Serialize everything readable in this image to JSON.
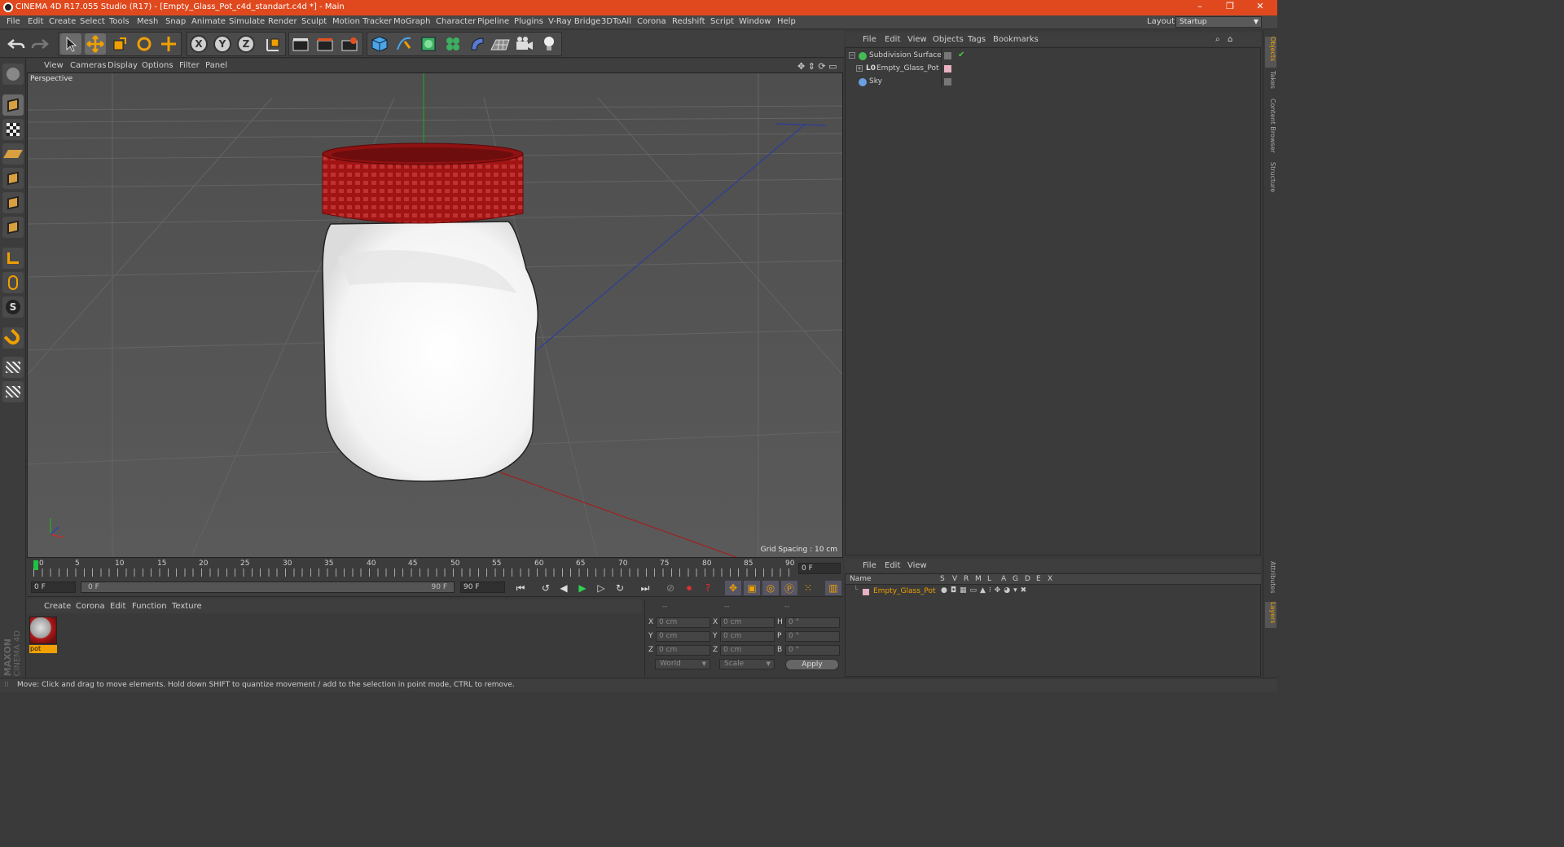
{
  "window": {
    "title": "CINEMA 4D R17.055 Studio (R17) - [Empty_Glass_Pot_c4d_standart.c4d *] - Main",
    "minimize": "–",
    "restore": "❐",
    "close": "✕"
  },
  "menubar": {
    "items": [
      "File",
      "Edit",
      "Create",
      "Select",
      "Tools",
      "Mesh",
      "Snap",
      "Animate",
      "Simulate",
      "Render",
      "Sculpt",
      "Motion Tracker",
      "MoGraph",
      "Character",
      "Pipeline",
      "Plugins",
      "V-Ray Bridge",
      "3DToAll",
      "Corona",
      "Redshift",
      "Script",
      "Window",
      "Help"
    ],
    "layout_label": "Layout:",
    "layout_value": "Startup"
  },
  "toolbar": {
    "axis_x": "X",
    "axis_y": "Y",
    "axis_z": "Z"
  },
  "viewport": {
    "menu": [
      "View",
      "Cameras",
      "Display",
      "Options",
      "Filter",
      "Panel"
    ],
    "label": "Perspective",
    "grid_spacing": "Grid Spacing : 10 cm"
  },
  "timeline": {
    "ticks": [
      "0",
      "5",
      "10",
      "15",
      "20",
      "25",
      "30",
      "35",
      "40",
      "45",
      "50",
      "55",
      "60",
      "65",
      "70",
      "75",
      "80",
      "85",
      "90"
    ],
    "current_frame": "0 F",
    "start_field": "0 F",
    "range_start": "0 F",
    "range_end": "90 F",
    "end_field": "90 F"
  },
  "material_manager": {
    "menu": [
      "Create",
      "Corona",
      "Edit",
      "Function",
      "Texture"
    ],
    "material_name": "pot"
  },
  "coordinates": {
    "header_dashes": [
      "--",
      "--",
      "--"
    ],
    "rows": [
      {
        "l1": "X",
        "v1": "0 cm",
        "l2": "X",
        "v2": "0 cm",
        "l3": "H",
        "v3": "0 °"
      },
      {
        "l1": "Y",
        "v1": "0 cm",
        "l2": "Y",
        "v2": "0 cm",
        "l3": "P",
        "v3": "0 °"
      },
      {
        "l1": "Z",
        "v1": "0 cm",
        "l2": "Z",
        "v2": "0 cm",
        "l3": "B",
        "v3": "0 °"
      }
    ],
    "mode1": "World",
    "mode2": "Scale",
    "apply": "Apply"
  },
  "object_manager": {
    "menu": [
      "File",
      "Edit",
      "View",
      "Objects",
      "Tags",
      "Bookmarks"
    ],
    "objects": [
      {
        "name": "Subdivision Surface",
        "icon_color": "#44bb55"
      },
      {
        "name": "Empty_Glass_Pot",
        "icon_color": "#dddddd"
      },
      {
        "name": "Sky",
        "icon_color": "#6aa0e0"
      }
    ]
  },
  "layer_manager": {
    "menu": [
      "File",
      "Edit",
      "View"
    ],
    "columns": [
      "Name",
      "S",
      "V",
      "R",
      "M",
      "L",
      "A",
      "G",
      "D",
      "E",
      "X"
    ],
    "row_name": "Empty_Glass_Pot"
  },
  "right_tabs": [
    "Objects",
    "Takes",
    "Content Browser",
    "Structure",
    "Attributes",
    "Layers"
  ],
  "statusbar": {
    "text": "Move: Click and drag to move elements. Hold down SHIFT to quantize movement / add to the selection in point mode, CTRL to remove."
  },
  "brand": {
    "maxon": "MAXON",
    "c4d": "CINEMA 4D"
  },
  "colors": {
    "titlebar": "#e0491e",
    "lid": "#b01818",
    "accent": "#f0a000"
  }
}
